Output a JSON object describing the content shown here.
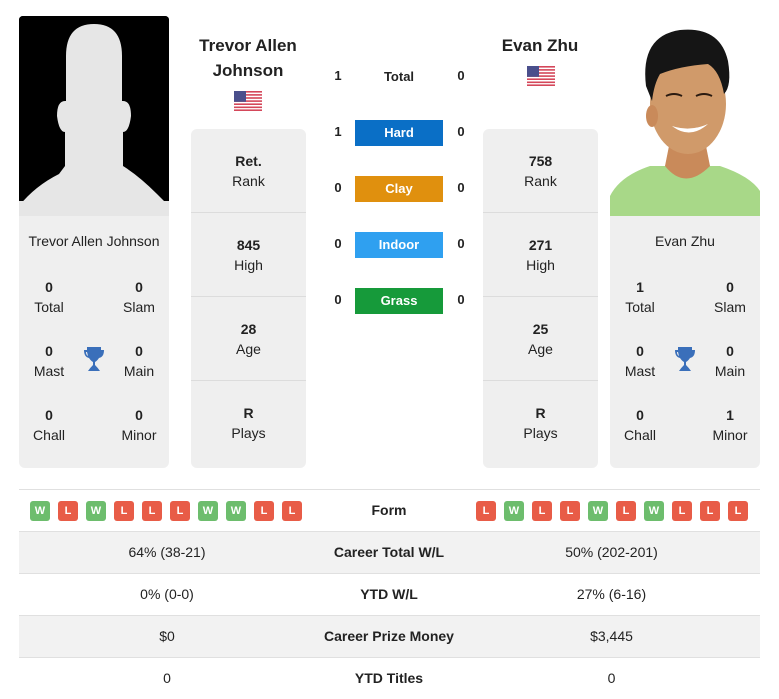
{
  "left_player": {
    "name": "Trevor Allen Johnson",
    "name_line1": "Trevor Allen",
    "name_line2": "Johnson",
    "flag": "us-flag-icon",
    "photo": "silhouette-placeholder",
    "titles": {
      "total": {
        "value": "0",
        "label": "Total"
      },
      "slam": {
        "value": "0",
        "label": "Slam"
      },
      "mast": {
        "value": "0",
        "label": "Mast"
      },
      "main": {
        "value": "0",
        "label": "Main"
      },
      "chall": {
        "value": "0",
        "label": "Chall"
      },
      "minor": {
        "value": "0",
        "label": "Minor"
      }
    },
    "stats": [
      {
        "value": "Ret.",
        "label": "Rank"
      },
      {
        "value": "845",
        "label": "High"
      },
      {
        "value": "28",
        "label": "Age"
      },
      {
        "value": "R",
        "label": "Plays"
      }
    ],
    "form": [
      "W",
      "L",
      "W",
      "L",
      "L",
      "L",
      "W",
      "W",
      "L",
      "L"
    ]
  },
  "right_player": {
    "name": "Evan Zhu",
    "flag": "us-flag-icon",
    "photo": "player-photo",
    "titles": {
      "total": {
        "value": "1",
        "label": "Total"
      },
      "slam": {
        "value": "0",
        "label": "Slam"
      },
      "mast": {
        "value": "0",
        "label": "Mast"
      },
      "main": {
        "value": "0",
        "label": "Main"
      },
      "chall": {
        "value": "0",
        "label": "Chall"
      },
      "minor": {
        "value": "1",
        "label": "Minor"
      }
    },
    "stats": [
      {
        "value": "758",
        "label": "Rank"
      },
      {
        "value": "271",
        "label": "High"
      },
      {
        "value": "25",
        "label": "Age"
      },
      {
        "value": "R",
        "label": "Plays"
      }
    ],
    "form": [
      "L",
      "W",
      "L",
      "L",
      "W",
      "L",
      "W",
      "L",
      "L",
      "L"
    ]
  },
  "h2h": [
    {
      "label": "Total",
      "left": "1",
      "right": "0",
      "color": ""
    },
    {
      "label": "Hard",
      "left": "1",
      "right": "0",
      "color": "#0a6fc6"
    },
    {
      "label": "Clay",
      "left": "0",
      "right": "0",
      "color": "#e0900e"
    },
    {
      "label": "Indoor",
      "left": "0",
      "right": "0",
      "color": "#2fa0f0"
    },
    {
      "label": "Grass",
      "left": "0",
      "right": "0",
      "color": "#169a3a"
    }
  ],
  "table": {
    "form_label": "Form",
    "rows": [
      {
        "label": "Career Total W/L",
        "left": "64% (38-21)",
        "right": "50% (202-201)"
      },
      {
        "label": "YTD W/L",
        "left": "0% (0-0)",
        "right": "27% (6-16)"
      },
      {
        "label": "Career Prize Money",
        "left": "$0",
        "right": "$3,445"
      },
      {
        "label": "YTD Titles",
        "left": "0",
        "right": "0"
      }
    ]
  },
  "colors": {
    "win": "#6dbd6d",
    "loss": "#e85c47",
    "trophy": "#3a6fba",
    "card_bg": "#efefef"
  }
}
